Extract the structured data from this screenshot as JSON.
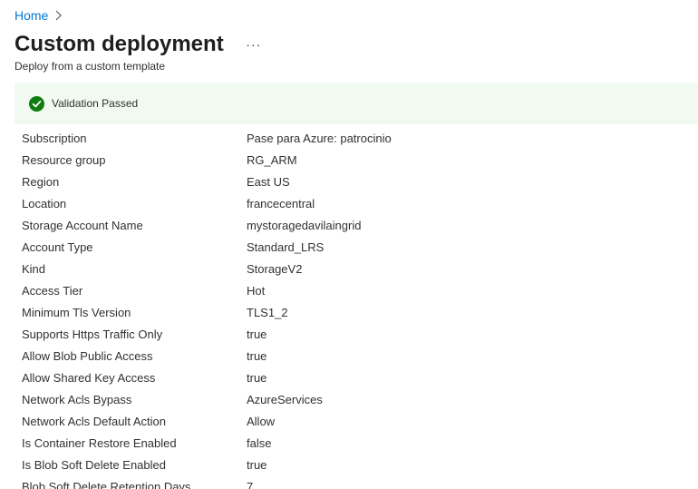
{
  "breadcrumb": {
    "home": "Home"
  },
  "header": {
    "title": "Custom deployment",
    "more": "···",
    "subtitle": "Deploy from a custom template"
  },
  "banner": {
    "message": "Validation Passed",
    "icon": "success-check-icon",
    "color": "#107c10",
    "background": "#f1faf0"
  },
  "details": [
    {
      "label": "Subscription",
      "value": "Pase para Azure: patrocinio"
    },
    {
      "label": "Resource group",
      "value": "RG_ARM"
    },
    {
      "label": "Region",
      "value": "East US"
    },
    {
      "label": "Location",
      "value": "francecentral"
    },
    {
      "label": "Storage Account Name",
      "value": "mystoragedavilaingrid"
    },
    {
      "label": "Account Type",
      "value": "Standard_LRS"
    },
    {
      "label": "Kind",
      "value": "StorageV2"
    },
    {
      "label": "Access Tier",
      "value": "Hot"
    },
    {
      "label": "Minimum Tls Version",
      "value": "TLS1_2"
    },
    {
      "label": "Supports Https Traffic Only",
      "value": "true"
    },
    {
      "label": "Allow Blob Public Access",
      "value": "true"
    },
    {
      "label": "Allow Shared Key Access",
      "value": "true"
    },
    {
      "label": "Network Acls Bypass",
      "value": "AzureServices"
    },
    {
      "label": "Network Acls Default Action",
      "value": "Allow"
    },
    {
      "label": "Is Container Restore Enabled",
      "value": "false"
    },
    {
      "label": "Is Blob Soft Delete Enabled",
      "value": "true"
    },
    {
      "label": "Blob Soft Delete Retention Days",
      "value": "7"
    }
  ]
}
